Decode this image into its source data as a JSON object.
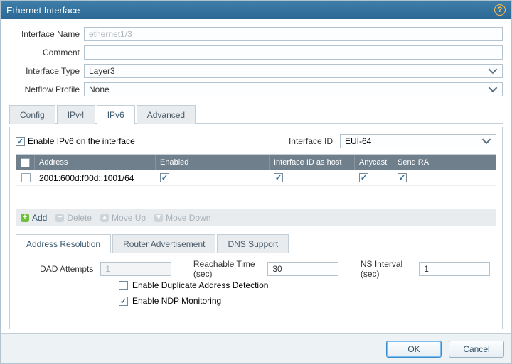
{
  "title": "Ethernet Interface",
  "labels": {
    "interface_name": "Interface Name",
    "comment": "Comment",
    "interface_type": "Interface Type",
    "netflow_profile": "Netflow Profile"
  },
  "fields": {
    "interface_name": "ethernet1/3",
    "comment": "",
    "interface_type": "Layer3",
    "netflow_profile": "None"
  },
  "tabs": {
    "config": "Config",
    "ipv4": "IPv4",
    "ipv6": "IPv6",
    "advanced": "Advanced"
  },
  "ipv6": {
    "enable_label": "Enable IPv6 on the interface",
    "enabled": true,
    "interface_id_label": "Interface ID",
    "interface_id_value": "EUI-64",
    "columns": {
      "address": "Address",
      "enabled": "Enabled",
      "iid_host": "Interface ID as host",
      "anycast": "Anycast",
      "send_ra": "Send RA"
    },
    "rows": [
      {
        "selected": false,
        "address": "2001:600d:f00d::1001/64",
        "enabled": true,
        "iid_host": true,
        "anycast": true,
        "send_ra": true
      }
    ],
    "toolbar": {
      "add": "Add",
      "delete": "Delete",
      "move_up": "Move Up",
      "move_down": "Move Down"
    },
    "subtabs": {
      "address_resolution": "Address Resolution",
      "router_advertisement": "Router Advertisement",
      "dns_support": "DNS Support"
    },
    "ar": {
      "dad_attempts_label": "DAD Attempts",
      "dad_attempts": "1",
      "reachable_label": "Reachable Time (sec)",
      "reachable": "30",
      "ns_interval_label": "NS Interval (sec)",
      "ns_interval": "1",
      "enable_dad_label": "Enable Duplicate Address Detection",
      "enable_dad": false,
      "enable_ndp_label": "Enable NDP Monitoring",
      "enable_ndp": true
    }
  },
  "footer": {
    "ok": "OK",
    "cancel": "Cancel"
  }
}
